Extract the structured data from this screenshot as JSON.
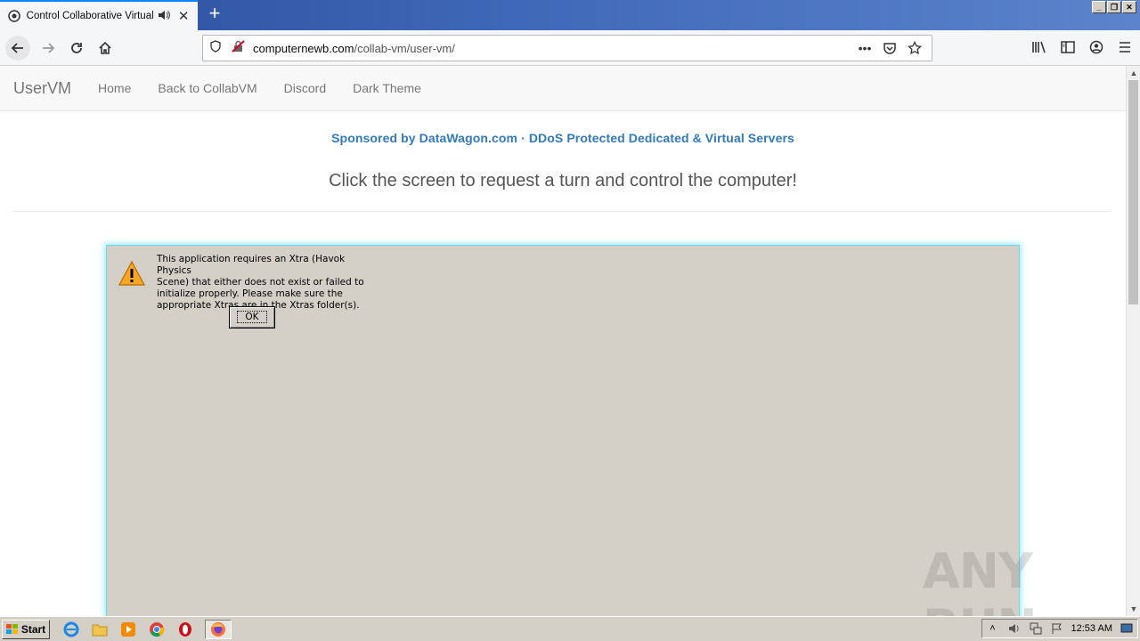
{
  "browser": {
    "tab_title": "Control Collaborative Virtual Machines",
    "new_tab_label": "+",
    "url_host": "computernewb.com",
    "url_path": "/collab-vm/user-vm/",
    "page_actions_label": "•••"
  },
  "site": {
    "brand": "UserVM",
    "nav": [
      "Home",
      "Back to CollabVM",
      "Discord",
      "Dark Theme"
    ],
    "sponsor": "Sponsored by DataWagon.com · DDoS Protected Dedicated & Virtual Servers",
    "headline": "Click the screen to request a turn and control the computer!"
  },
  "vm": {
    "alert_lines": [
      "This application requires an Xtra (Havok Physics",
      "Scene) that either does not exist or failed to",
      "initialize properly.  Please make sure the",
      "appropriate Xtras are in the Xtras folder(s)."
    ],
    "ok_label": "OK"
  },
  "watermark": "ANY RUN",
  "taskbar": {
    "start_label": "Start",
    "clock": "12:53 AM",
    "quick_icons": [
      "ie-icon",
      "explorer-icon",
      "media-player-icon",
      "chrome-icon",
      "opera-icon",
      "firefox-icon"
    ]
  },
  "colors": {
    "link": "#337ab7",
    "vm_bg": "#d4d0c8",
    "vm_glow": "#66d9ff",
    "tab_accent": "#0a84ff"
  }
}
